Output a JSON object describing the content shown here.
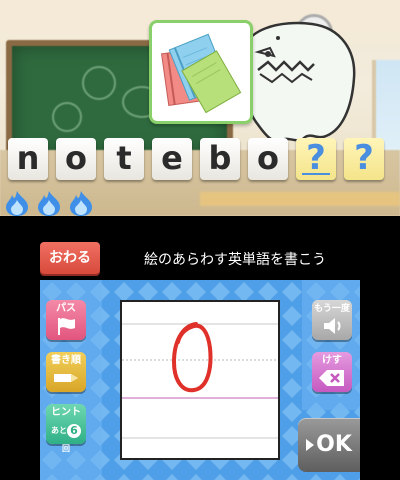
{
  "top_screen": {
    "letters": [
      {
        "char": "n",
        "known": true
      },
      {
        "char": "o",
        "known": true
      },
      {
        "char": "t",
        "known": true
      },
      {
        "char": "e",
        "known": true
      },
      {
        "char": "b",
        "known": true
      },
      {
        "char": "o",
        "known": true
      },
      {
        "char": "?",
        "known": false
      },
      {
        "char": "?",
        "known": false
      }
    ],
    "picture_icon": "notebook-icon",
    "lives_icon": "blue-flame-icon",
    "lives": 3
  },
  "bottom_screen": {
    "quit_label": "おわる",
    "instruction": "絵のあらわす英単語を書こう",
    "pass_label": "パス",
    "stroke_order_label": "書き順",
    "hint_label": "ヒント",
    "hint_count_prefix": "あと",
    "hint_count": "6",
    "hint_count_suffix": "回",
    "repeat_label": "もう一度",
    "erase_label": "けす",
    "ok_label": "OK"
  },
  "colors": {
    "panel_blue": "#4e9fe8",
    "ink_red": "#e0302a",
    "unknown_letter": "#4a8ee0"
  }
}
